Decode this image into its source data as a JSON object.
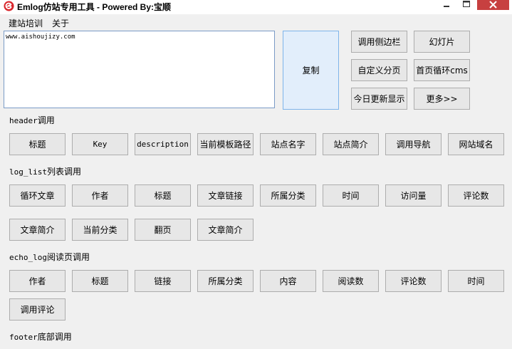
{
  "window": {
    "title": "Emlog仿站专用工具 - Powered By:宝顺",
    "controls": {
      "minimize": "–",
      "maximize": "□",
      "close": "✕"
    }
  },
  "menu": [
    "建站培训",
    "关于"
  ],
  "editor": {
    "value": "www.aishoujizy.com"
  },
  "copy_button": "复制",
  "top_buttons": [
    "调用侧边栏",
    "幻灯片",
    "自定义分页",
    "首页循环cms",
    "今日更新显示",
    "更多>>"
  ],
  "sections": {
    "header": {
      "label_prefix": "header",
      "label_suffix": "调用",
      "buttons": [
        "标题",
        "Key",
        "description",
        "当前模板路径",
        "站点名字",
        "站点简介",
        "调用导航",
        "网站域名"
      ]
    },
    "log_list": {
      "label_prefix": "log_list",
      "label_suffix": "列表调用",
      "buttons_row1": [
        "循环文章",
        "作者",
        "标题",
        "文章链接",
        "所属分类",
        "时间",
        "访问量",
        "评论数"
      ],
      "buttons_row2": [
        "文章简介",
        "当前分类",
        "翻页",
        "文章简介"
      ]
    },
    "echo_log": {
      "label_prefix": "echo_log",
      "label_suffix": "阅读页调用",
      "buttons_row1": [
        "作者",
        "标题",
        "链接",
        "所属分类",
        "内容",
        "阅读数",
        "评论数",
        "时间"
      ],
      "buttons_row2": [
        "调用评论"
      ]
    },
    "footer": {
      "label_prefix": "footer",
      "label_suffix": "底部调用"
    }
  },
  "colors": {
    "accent_close": "#c74040",
    "copy_button_bg": "#e2eefb",
    "button_bg": "#e7e7e7",
    "window_bg": "#f0f0f0",
    "app_icon": "#d9262c"
  }
}
